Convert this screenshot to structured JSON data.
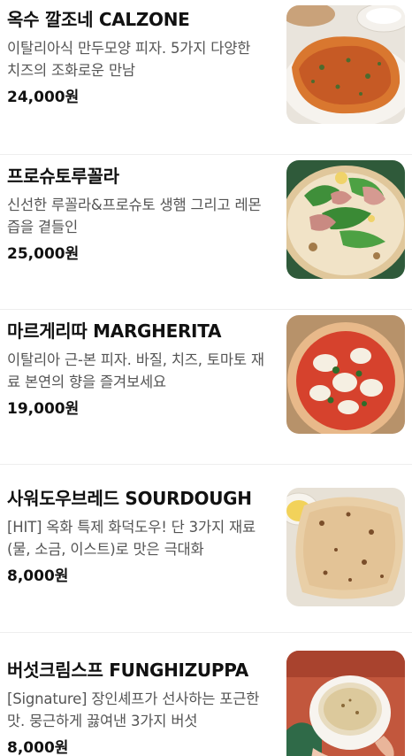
{
  "menu_items": [
    {
      "name": "옥수 깔조네 CALZONE",
      "description": "이탈리아식 만두모양 피자. 5가지 다양한 치즈의 조화로운 만남",
      "price": "24,000원",
      "image": "calzone-photo"
    },
    {
      "name": "프로슈토루꼴라",
      "description": "신선한 루꼴라&프로슈토 생햄 그리고 레몬즙을 곁들인",
      "price": "25,000원",
      "image": "prosciutto-arugula-pizza-photo"
    },
    {
      "name": "마르게리따 MARGHERITA",
      "description": "이탈리아 근-본 피자. 바질, 치즈, 토마토 재료 본연의 향을 즐겨보세요",
      "price": "19,000원",
      "image": "margherita-pizza-photo"
    },
    {
      "name": "사워도우브레드 SOURDOUGH",
      "description": "[HIT] 옥화 특제 화덕도우! 단 3가지 재료(물, 소금, 이스트)로 맛은 극대화",
      "price": "8,000원",
      "image": "sourdough-bread-photo"
    },
    {
      "name": "버섯크림스프 FUNGHIZUPPA",
      "description": "[Signature] 장인셰프가 선사하는 포근한 맛. 뭉근하게 끓여낸 3가지 버섯",
      "price": "8,000원",
      "image": "mushroom-cream-soup-photo"
    }
  ]
}
